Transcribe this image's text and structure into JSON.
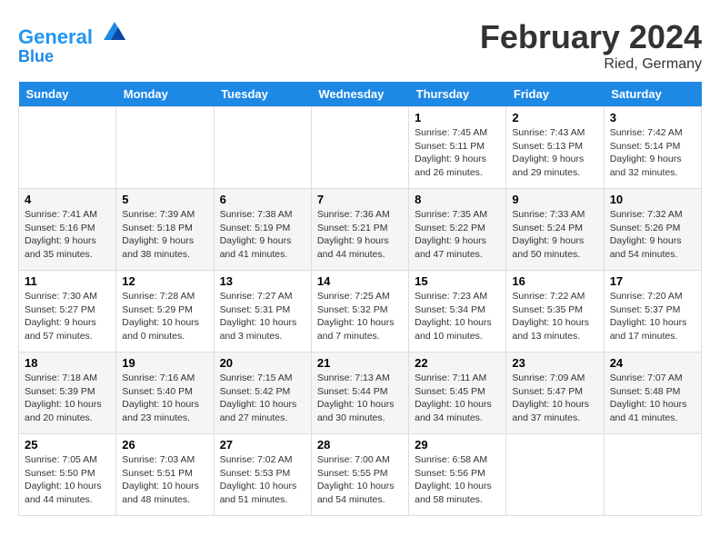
{
  "header": {
    "logo_line1": "General",
    "logo_line2": "Blue",
    "month": "February 2024",
    "location": "Ried, Germany"
  },
  "weekdays": [
    "Sunday",
    "Monday",
    "Tuesday",
    "Wednesday",
    "Thursday",
    "Friday",
    "Saturday"
  ],
  "weeks": [
    [
      {
        "day": "",
        "sunrise": "",
        "sunset": "",
        "daylight": ""
      },
      {
        "day": "",
        "sunrise": "",
        "sunset": "",
        "daylight": ""
      },
      {
        "day": "",
        "sunrise": "",
        "sunset": "",
        "daylight": ""
      },
      {
        "day": "",
        "sunrise": "",
        "sunset": "",
        "daylight": ""
      },
      {
        "day": "1",
        "sunrise": "Sunrise: 7:45 AM",
        "sunset": "Sunset: 5:11 PM",
        "daylight": "Daylight: 9 hours and 26 minutes."
      },
      {
        "day": "2",
        "sunrise": "Sunrise: 7:43 AM",
        "sunset": "Sunset: 5:13 PM",
        "daylight": "Daylight: 9 hours and 29 minutes."
      },
      {
        "day": "3",
        "sunrise": "Sunrise: 7:42 AM",
        "sunset": "Sunset: 5:14 PM",
        "daylight": "Daylight: 9 hours and 32 minutes."
      }
    ],
    [
      {
        "day": "4",
        "sunrise": "Sunrise: 7:41 AM",
        "sunset": "Sunset: 5:16 PM",
        "daylight": "Daylight: 9 hours and 35 minutes."
      },
      {
        "day": "5",
        "sunrise": "Sunrise: 7:39 AM",
        "sunset": "Sunset: 5:18 PM",
        "daylight": "Daylight: 9 hours and 38 minutes."
      },
      {
        "day": "6",
        "sunrise": "Sunrise: 7:38 AM",
        "sunset": "Sunset: 5:19 PM",
        "daylight": "Daylight: 9 hours and 41 minutes."
      },
      {
        "day": "7",
        "sunrise": "Sunrise: 7:36 AM",
        "sunset": "Sunset: 5:21 PM",
        "daylight": "Daylight: 9 hours and 44 minutes."
      },
      {
        "day": "8",
        "sunrise": "Sunrise: 7:35 AM",
        "sunset": "Sunset: 5:22 PM",
        "daylight": "Daylight: 9 hours and 47 minutes."
      },
      {
        "day": "9",
        "sunrise": "Sunrise: 7:33 AM",
        "sunset": "Sunset: 5:24 PM",
        "daylight": "Daylight: 9 hours and 50 minutes."
      },
      {
        "day": "10",
        "sunrise": "Sunrise: 7:32 AM",
        "sunset": "Sunset: 5:26 PM",
        "daylight": "Daylight: 9 hours and 54 minutes."
      }
    ],
    [
      {
        "day": "11",
        "sunrise": "Sunrise: 7:30 AM",
        "sunset": "Sunset: 5:27 PM",
        "daylight": "Daylight: 9 hours and 57 minutes."
      },
      {
        "day": "12",
        "sunrise": "Sunrise: 7:28 AM",
        "sunset": "Sunset: 5:29 PM",
        "daylight": "Daylight: 10 hours and 0 minutes."
      },
      {
        "day": "13",
        "sunrise": "Sunrise: 7:27 AM",
        "sunset": "Sunset: 5:31 PM",
        "daylight": "Daylight: 10 hours and 3 minutes."
      },
      {
        "day": "14",
        "sunrise": "Sunrise: 7:25 AM",
        "sunset": "Sunset: 5:32 PM",
        "daylight": "Daylight: 10 hours and 7 minutes."
      },
      {
        "day": "15",
        "sunrise": "Sunrise: 7:23 AM",
        "sunset": "Sunset: 5:34 PM",
        "daylight": "Daylight: 10 hours and 10 minutes."
      },
      {
        "day": "16",
        "sunrise": "Sunrise: 7:22 AM",
        "sunset": "Sunset: 5:35 PM",
        "daylight": "Daylight: 10 hours and 13 minutes."
      },
      {
        "day": "17",
        "sunrise": "Sunrise: 7:20 AM",
        "sunset": "Sunset: 5:37 PM",
        "daylight": "Daylight: 10 hours and 17 minutes."
      }
    ],
    [
      {
        "day": "18",
        "sunrise": "Sunrise: 7:18 AM",
        "sunset": "Sunset: 5:39 PM",
        "daylight": "Daylight: 10 hours and 20 minutes."
      },
      {
        "day": "19",
        "sunrise": "Sunrise: 7:16 AM",
        "sunset": "Sunset: 5:40 PM",
        "daylight": "Daylight: 10 hours and 23 minutes."
      },
      {
        "day": "20",
        "sunrise": "Sunrise: 7:15 AM",
        "sunset": "Sunset: 5:42 PM",
        "daylight": "Daylight: 10 hours and 27 minutes."
      },
      {
        "day": "21",
        "sunrise": "Sunrise: 7:13 AM",
        "sunset": "Sunset: 5:44 PM",
        "daylight": "Daylight: 10 hours and 30 minutes."
      },
      {
        "day": "22",
        "sunrise": "Sunrise: 7:11 AM",
        "sunset": "Sunset: 5:45 PM",
        "daylight": "Daylight: 10 hours and 34 minutes."
      },
      {
        "day": "23",
        "sunrise": "Sunrise: 7:09 AM",
        "sunset": "Sunset: 5:47 PM",
        "daylight": "Daylight: 10 hours and 37 minutes."
      },
      {
        "day": "24",
        "sunrise": "Sunrise: 7:07 AM",
        "sunset": "Sunset: 5:48 PM",
        "daylight": "Daylight: 10 hours and 41 minutes."
      }
    ],
    [
      {
        "day": "25",
        "sunrise": "Sunrise: 7:05 AM",
        "sunset": "Sunset: 5:50 PM",
        "daylight": "Daylight: 10 hours and 44 minutes."
      },
      {
        "day": "26",
        "sunrise": "Sunrise: 7:03 AM",
        "sunset": "Sunset: 5:51 PM",
        "daylight": "Daylight: 10 hours and 48 minutes."
      },
      {
        "day": "27",
        "sunrise": "Sunrise: 7:02 AM",
        "sunset": "Sunset: 5:53 PM",
        "daylight": "Daylight: 10 hours and 51 minutes."
      },
      {
        "day": "28",
        "sunrise": "Sunrise: 7:00 AM",
        "sunset": "Sunset: 5:55 PM",
        "daylight": "Daylight: 10 hours and 54 minutes."
      },
      {
        "day": "29",
        "sunrise": "Sunrise: 6:58 AM",
        "sunset": "Sunset: 5:56 PM",
        "daylight": "Daylight: 10 hours and 58 minutes."
      },
      {
        "day": "",
        "sunrise": "",
        "sunset": "",
        "daylight": ""
      },
      {
        "day": "",
        "sunrise": "",
        "sunset": "",
        "daylight": ""
      }
    ]
  ]
}
